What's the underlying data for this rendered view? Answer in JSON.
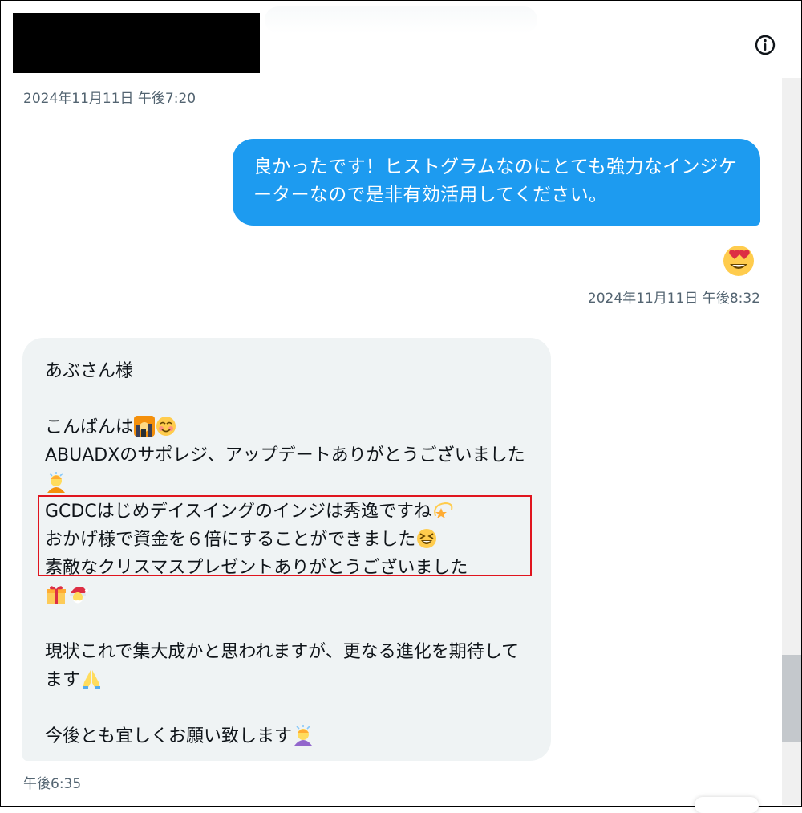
{
  "header": {
    "info_icon": "info-icon",
    "redaction": "redacted-name-block"
  },
  "timestamps": {
    "first": "2024年11月11日 午後7:20",
    "second": "2024年11月11日 午後8:32",
    "third": "午後6:35"
  },
  "messages": {
    "outgoing": {
      "text": "良かったです！ヒストグラムなのにとても強力なインジケーターなので是非有効活用してください。",
      "color": "#1d9bf0",
      "reaction_icon": "heart-eyes-emoji-icon"
    },
    "incoming": {
      "color": "#eff3f4",
      "lines": [
        "あぶさん様",
        "こんばんは",
        "ABUADXのサポレジ、アップデートありがとうございました",
        "GCDCはじめデイスイングのインジは秀逸ですね",
        "おかげ様で資金を６倍にすることができました",
        "素敵なクリスマスプレゼントありがとうございました",
        "現状これで集大成かと思われますが、更なる進化を期待してます",
        "今後とも宜しくお願い致します"
      ],
      "emoji": [
        "city-dusk-icon",
        "smiling-face-icon",
        "bowing-person-icon",
        "dizzy-star-icon",
        "grinning-squint-icon",
        "gift-icon",
        "santa-icon",
        "folded-hands-icon",
        "bowing-person-icon"
      ]
    }
  },
  "highlight": {
    "color": "#e0141e"
  }
}
